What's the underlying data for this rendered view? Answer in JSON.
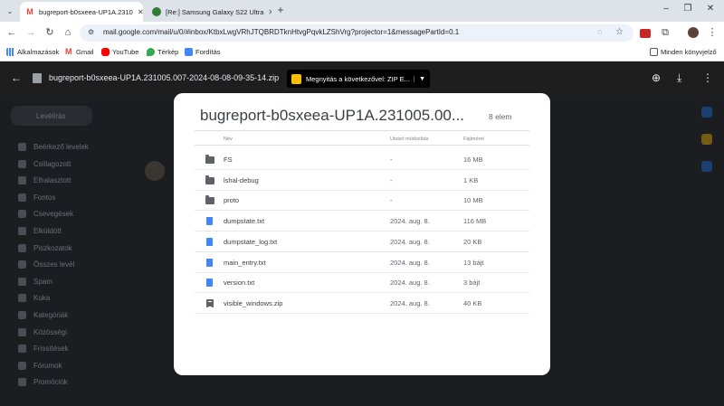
{
  "browser": {
    "tabs": [
      {
        "title": "bugreport-b0sxeea-UP1A.2310",
        "icon": "gmail-icon",
        "active": true
      },
      {
        "title": "[Re:] Samsung Galaxy S22 Ultra",
        "icon": "site-icon",
        "active": false
      }
    ],
    "url": "mail.google.com/mail/u/0/#inbox/KtbxLwgVRhJTQBRDTknHtvgPqvkLZShVrg?projector=1&messagePartId=0.1",
    "bookmarks": [
      {
        "label": "Alkalmazások",
        "icon": "apps-icon"
      },
      {
        "label": "Gmail",
        "icon": "gmail-icon"
      },
      {
        "label": "YouTube",
        "icon": "youtube-icon"
      },
      {
        "label": "Térkép",
        "icon": "maps-icon"
      },
      {
        "label": "Fordítás",
        "icon": "translate-icon"
      }
    ],
    "other_bookmarks": "Minden könyvjelző",
    "colors": {
      "chrome": "#dee3ea",
      "accent": "#0b57d0"
    }
  },
  "viewer": {
    "filename": "bugreport-b0sxeea-UP1A.231005.007-2024-08-08-09-35-14.zip",
    "open_with": "Megnyitás a következővel: ZIP E..."
  },
  "gmail_sidebar": {
    "compose": "Levélírás",
    "items": [
      "Beérkező levelek",
      "Csillagozott",
      "Elhalasztott",
      "Fontos",
      "Csevegések",
      "Elküldött",
      "Piszkozatok",
      "Összes levél",
      "Spam",
      "Kuka",
      "Kategóriák",
      "Közösségi",
      "Frissítések",
      "Fórumok",
      "Promóciók"
    ]
  },
  "dialog": {
    "title": "bugreport-b0sxeea-UP1A.231005.00...",
    "count": "8 elem",
    "headers": {
      "name": "Név",
      "modified": "Utolsó módosítás",
      "size": "Fájlméret"
    },
    "files": [
      {
        "name": "FS",
        "modified": "-",
        "size": "16 MB",
        "icon": "folder-icon"
      },
      {
        "name": "lshal-debug",
        "modified": "-",
        "size": "1 KB",
        "icon": "folder-icon"
      },
      {
        "name": "proto",
        "modified": "-",
        "size": "10 MB",
        "icon": "folder-icon"
      },
      {
        "name": "dumpstate.txt",
        "modified": "2024. aug. 8.",
        "size": "116 MB",
        "icon": "doc-icon"
      },
      {
        "name": "dumpstate_log.txt",
        "modified": "2024. aug. 8.",
        "size": "20 KB",
        "icon": "doc-icon"
      },
      {
        "name": "main_entry.txt",
        "modified": "2024. aug. 8.",
        "size": "13 bájt",
        "icon": "doc-icon"
      },
      {
        "name": "version.txt",
        "modified": "2024. aug. 8.",
        "size": "3 bájt",
        "icon": "doc-icon"
      },
      {
        "name": "visible_windows.zip",
        "modified": "2024. aug. 8.",
        "size": "40 KB",
        "icon": "zip-icon"
      }
    ]
  }
}
